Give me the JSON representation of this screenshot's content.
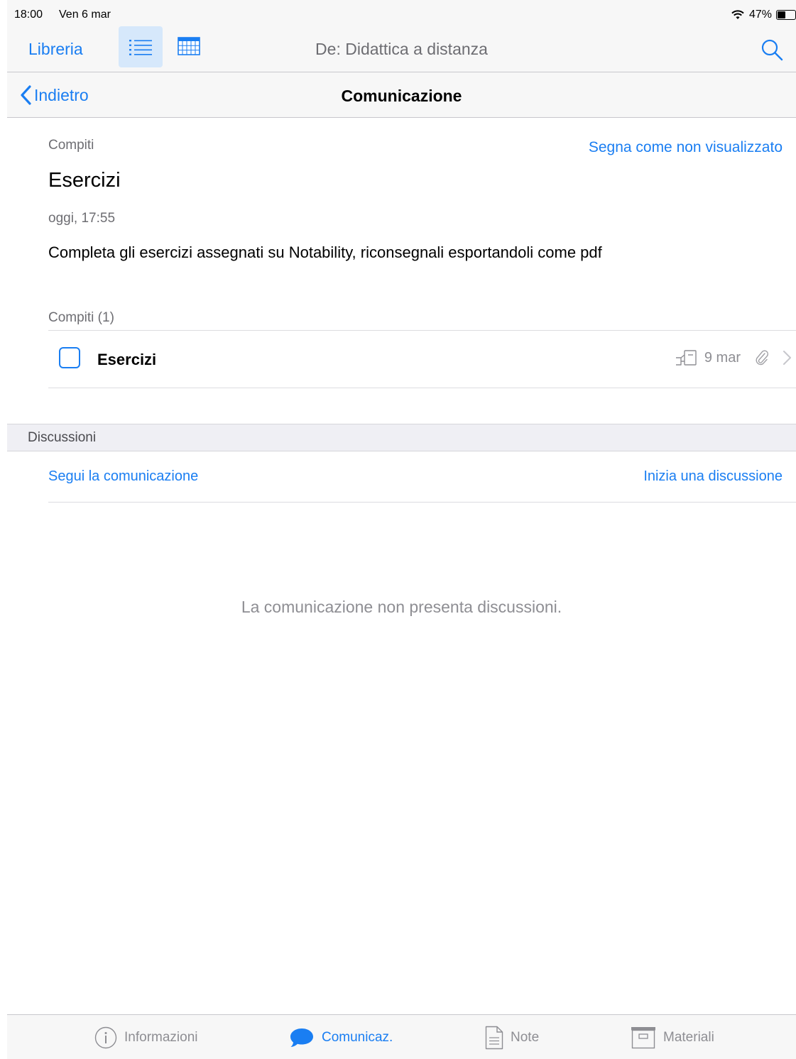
{
  "status_bar": {
    "time": "18:00",
    "date": "Ven 6 mar",
    "battery": "47%",
    "battery_level": 0.47
  },
  "top_nav": {
    "library_label": "Libreria",
    "title": "De: Didattica a distanza"
  },
  "sub_nav": {
    "back_label": "Indietro",
    "title": "Comunicazione"
  },
  "post": {
    "category": "Compiti",
    "mark_unread_label": "Segna come non visualizzato",
    "title": "Esercizi",
    "time": "oggi, 17:55",
    "body": "Completa gli esercizi assegnati su Notability, riconsegnali esportandoli come pdf"
  },
  "tasks": {
    "header": "Compiti (1)",
    "items": [
      {
        "title": "Esercizi",
        "due": "9 mar",
        "checked": false
      }
    ]
  },
  "discussions": {
    "header": "Discussioni",
    "follow_label": "Segui la comunicazione",
    "start_label": "Inizia una discussione",
    "empty_message": "La comunicazione non presenta discussioni."
  },
  "tab_bar": {
    "items": [
      {
        "label": "Informazioni",
        "icon": "info-icon"
      },
      {
        "label": "Comunicaz.",
        "icon": "speech-bubble-icon",
        "active": true
      },
      {
        "label": "Note",
        "icon": "note-icon"
      },
      {
        "label": "Materiali",
        "icon": "archive-box-icon"
      }
    ]
  },
  "colors": {
    "accent": "#1a7ef2",
    "secondary_text": "#6d6d72",
    "bar_bg": "#f7f7f7"
  }
}
